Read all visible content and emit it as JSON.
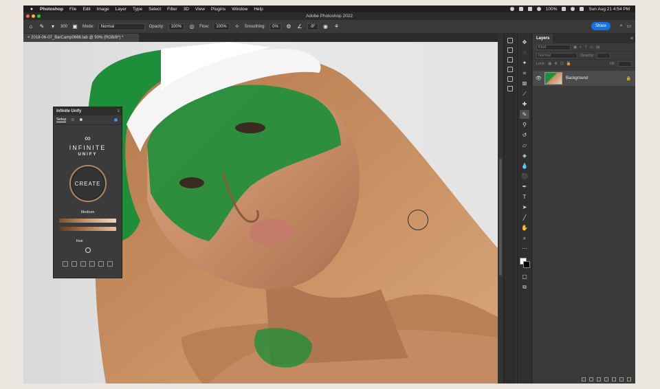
{
  "menubar": {
    "apple": "",
    "items": [
      "Photoshop",
      "File",
      "Edit",
      "Image",
      "Layer",
      "Type",
      "Select",
      "Filter",
      "3D",
      "View",
      "Plugins",
      "Window",
      "Help"
    ],
    "battery": "100%",
    "datetime": "Sun Aug 21  4:54 PM"
  },
  "window": {
    "title": "Adobe Photoshop 2022"
  },
  "options": {
    "brush_size": "300",
    "mode_label": "Mode:",
    "mode_value": "Normal",
    "opacity_label": "Opacity:",
    "opacity_value": "100%",
    "flow_label": "Flow:",
    "flow_value": "100%",
    "smoothing_label": "Smoothing:",
    "smoothing_value": "0%",
    "angle_value": "-9°",
    "share_label": "Share"
  },
  "document": {
    "tab_label": "2018-06-07_BarCamp0666.tab @ 50% (RGB/8*) *"
  },
  "plugin": {
    "title": "Infinite Unify",
    "tab_setup": "Setup",
    "brand_line1": "INFINITE",
    "brand_line2": "UNIFY",
    "create_label": "CREATE",
    "level_selected": "Medium",
    "hue_label": "Hue"
  },
  "layers": {
    "tab_label": "Layers",
    "kind_placeholder": "Kind",
    "blend_mode": "Normal",
    "opacity_label": "Opacity:",
    "lock_label": "Lock:",
    "fill_label": "Fill:",
    "layer_name": "Background"
  },
  "colors": {
    "accent": "#1473e6",
    "green_cap": "#1f8e3a",
    "create_ring": "#b08760"
  }
}
